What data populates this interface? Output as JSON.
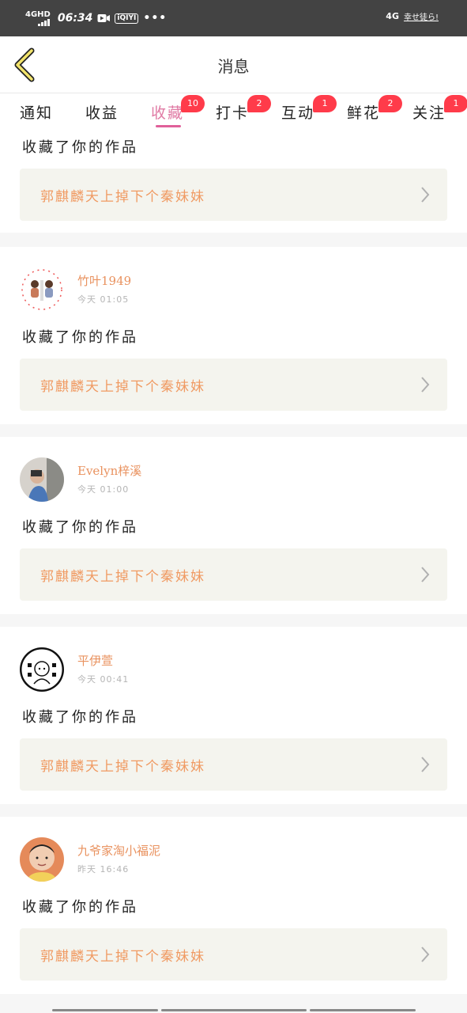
{
  "status_bar": {
    "network": "4GHD",
    "time": "06:34",
    "app_icon_label": "iQIYI",
    "dots": "•••",
    "right_network": "4G",
    "carrier": "幸せ徒ら!"
  },
  "header": {
    "title": "消息",
    "back_icon": "chevron-left-icon"
  },
  "tabs": [
    {
      "label": "通知",
      "badge": ""
    },
    {
      "label": "收益",
      "badge": ""
    },
    {
      "label": "收藏",
      "badge": "10",
      "active": true
    },
    {
      "label": "打卡",
      "badge": "2"
    },
    {
      "label": "互动",
      "badge": "1"
    },
    {
      "label": "鲜花",
      "badge": "2"
    },
    {
      "label": "关注",
      "badge": "1"
    }
  ],
  "colors": {
    "accent_pink": "#e0609a",
    "orange_text": "#f09a62",
    "badge_red": "#ff3b4a",
    "status_bar": "#434343"
  },
  "items": [
    {
      "username": "",
      "time": "",
      "action": "收藏了你的作品",
      "work": "郭麒麟天上掉下个秦妹妹"
    },
    {
      "username": "竹叶1949",
      "time": "今天 01:05",
      "action": "收藏了你的作品",
      "work": "郭麒麟天上掉下个秦妹妹"
    },
    {
      "username": "Evelyn梓溪",
      "time": "今天 01:00",
      "action": "收藏了你的作品",
      "work": "郭麒麟天上掉下个秦妹妹"
    },
    {
      "username": "平伊萱",
      "time": "今天 00:41",
      "action": "收藏了你的作品",
      "work": "郭麒麟天上掉下个秦妹妹"
    },
    {
      "username": "九爷家淘小福泥",
      "time": "昨天 16:46",
      "action": "收藏了你的作品",
      "work": "郭麒麟天上掉下个秦妹妹"
    }
  ]
}
